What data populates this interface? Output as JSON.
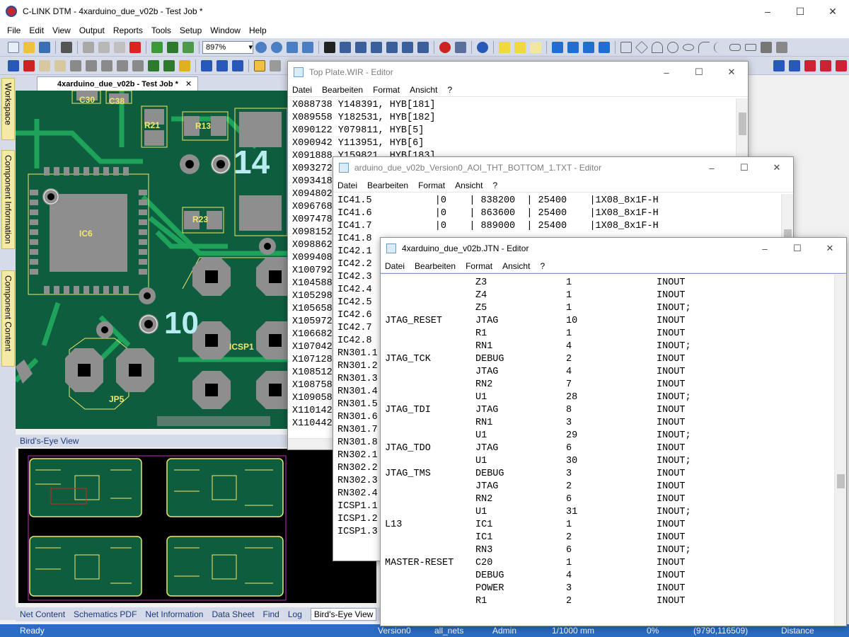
{
  "app": {
    "title": "C-LINK DTM - 4xarduino_due_v02b - Test Job *",
    "window_buttons": [
      "–",
      "☐",
      "✕"
    ]
  },
  "menu": [
    "File",
    "Edit",
    "View",
    "Output",
    "Reports",
    "Tools",
    "Setup",
    "Window",
    "Help"
  ],
  "toolbar": {
    "zoom_value": "897%"
  },
  "sidebar_tabs": [
    "Workspace",
    "Component Information",
    "Component Content"
  ],
  "doc_tab": {
    "label": "4xarduino_due_v02b - Test Job *",
    "close": "✕"
  },
  "pcb": {
    "labels": [
      "C30",
      "C38",
      "R21",
      "R13",
      "R23",
      "IC6",
      "ICSP1",
      "JP5",
      "14",
      "10"
    ]
  },
  "birds_eye": {
    "title": "Bird's-Eye View"
  },
  "bottom_tabs": [
    "Net Content",
    "Schematics PDF",
    "Net Information",
    "Data Sheet",
    "Find",
    "Log",
    "Bird's-Eye View"
  ],
  "status": {
    "ready": "Ready",
    "version": "Version0",
    "nets": "all_nets",
    "user": "Admin",
    "unit": "1/1000 mm",
    "percent": "0%",
    "coords": "(9790,116509)",
    "mode": "Distance"
  },
  "editor_wir": {
    "title": "Top Plate.WIR - Editor",
    "menu": [
      "Datei",
      "Bearbeiten",
      "Format",
      "Ansicht",
      "?"
    ],
    "lines": [
      "X088738 Y148391, HYB[181]",
      "X089558 Y182531, HYB[182]",
      "X090122 Y079811, HYB[5]",
      "X090942 Y113951, HYB[6]",
      "X091888 Y159821, HYB[183]",
      "X093272",
      "X093418",
      "X094802",
      "X096768",
      "X097478",
      "X098152",
      "X098862",
      "X099408",
      "X100792",
      "X104588",
      "X105298",
      "X105658",
      "X105972",
      "X106682",
      "X107042",
      "X107128",
      "X108512",
      "X108758",
      "X109058",
      "X110142",
      "X110442"
    ]
  },
  "editor_aoi": {
    "title": "arduino_due_v02b_Version0_AOI_THT_BOTTOM_1.TXT - Editor",
    "menu": [
      "Datei",
      "Bearbeiten",
      "Format",
      "Ansicht",
      "?"
    ],
    "lines": [
      "IC41.5           |0    | 838200  | 25400    |1X08_8x1F-H",
      "IC41.6           |0    | 863600  | 25400    |1X08_8x1F-H",
      "IC41.7           |0    | 889000  | 25400    |1X08_8x1F-H",
      "IC41.8",
      "IC42.1",
      "IC42.2",
      "IC42.3",
      "IC42.4",
      "IC42.5",
      "IC42.6",
      "IC42.7",
      "IC42.8",
      "RN301.1",
      "RN301.2",
      "RN301.3",
      "RN301.4",
      "RN301.5",
      "RN301.6",
      "RN301.7",
      "RN301.8",
      "RN302.1",
      "RN302.2",
      "RN302.3",
      "RN302.4",
      "ICSP1.1",
      "ICSP1.2",
      "ICSP1.3"
    ]
  },
  "editor_jtn": {
    "title": "4xarduino_due_v02b.JTN - Editor",
    "menu": [
      "Datei",
      "Bearbeiten",
      "Format",
      "Ansicht",
      "?"
    ],
    "rows": [
      [
        "",
        "Z3",
        "1",
        "INOUT"
      ],
      [
        "",
        "Z4",
        "1",
        "INOUT"
      ],
      [
        "",
        "Z5",
        "1",
        "INOUT;"
      ],
      [
        "JTAG_RESET",
        "JTAG",
        "10",
        "INOUT"
      ],
      [
        "",
        "R1",
        "1",
        "INOUT"
      ],
      [
        "",
        "RN1",
        "4",
        "INOUT;"
      ],
      [
        "JTAG_TCK",
        "DEBUG",
        "2",
        "INOUT"
      ],
      [
        "",
        "JTAG",
        "4",
        "INOUT"
      ],
      [
        "",
        "RN2",
        "7",
        "INOUT"
      ],
      [
        "",
        "U1",
        "28",
        "INOUT;"
      ],
      [
        "JTAG_TDI",
        "JTAG",
        "8",
        "INOUT"
      ],
      [
        "",
        "RN1",
        "3",
        "INOUT"
      ],
      [
        "",
        "U1",
        "29",
        "INOUT;"
      ],
      [
        "JTAG_TDO",
        "JTAG",
        "6",
        "INOUT"
      ],
      [
        "",
        "U1",
        "30",
        "INOUT;"
      ],
      [
        "JTAG_TMS",
        "DEBUG",
        "3",
        "INOUT"
      ],
      [
        "",
        "JTAG",
        "2",
        "INOUT"
      ],
      [
        "",
        "RN2",
        "6",
        "INOUT"
      ],
      [
        "",
        "U1",
        "31",
        "INOUT;"
      ],
      [
        "L13",
        "IC1",
        "1",
        "INOUT"
      ],
      [
        "",
        "IC1",
        "2",
        "INOUT"
      ],
      [
        "",
        "RN3",
        "6",
        "INOUT;"
      ],
      [
        "MASTER-RESET",
        "C20",
        "1",
        "INOUT"
      ],
      [
        "",
        "DEBUG",
        "4",
        "INOUT"
      ],
      [
        "",
        "POWER",
        "3",
        "INOUT"
      ],
      [
        "",
        "R1",
        "2",
        "INOUT"
      ]
    ]
  }
}
